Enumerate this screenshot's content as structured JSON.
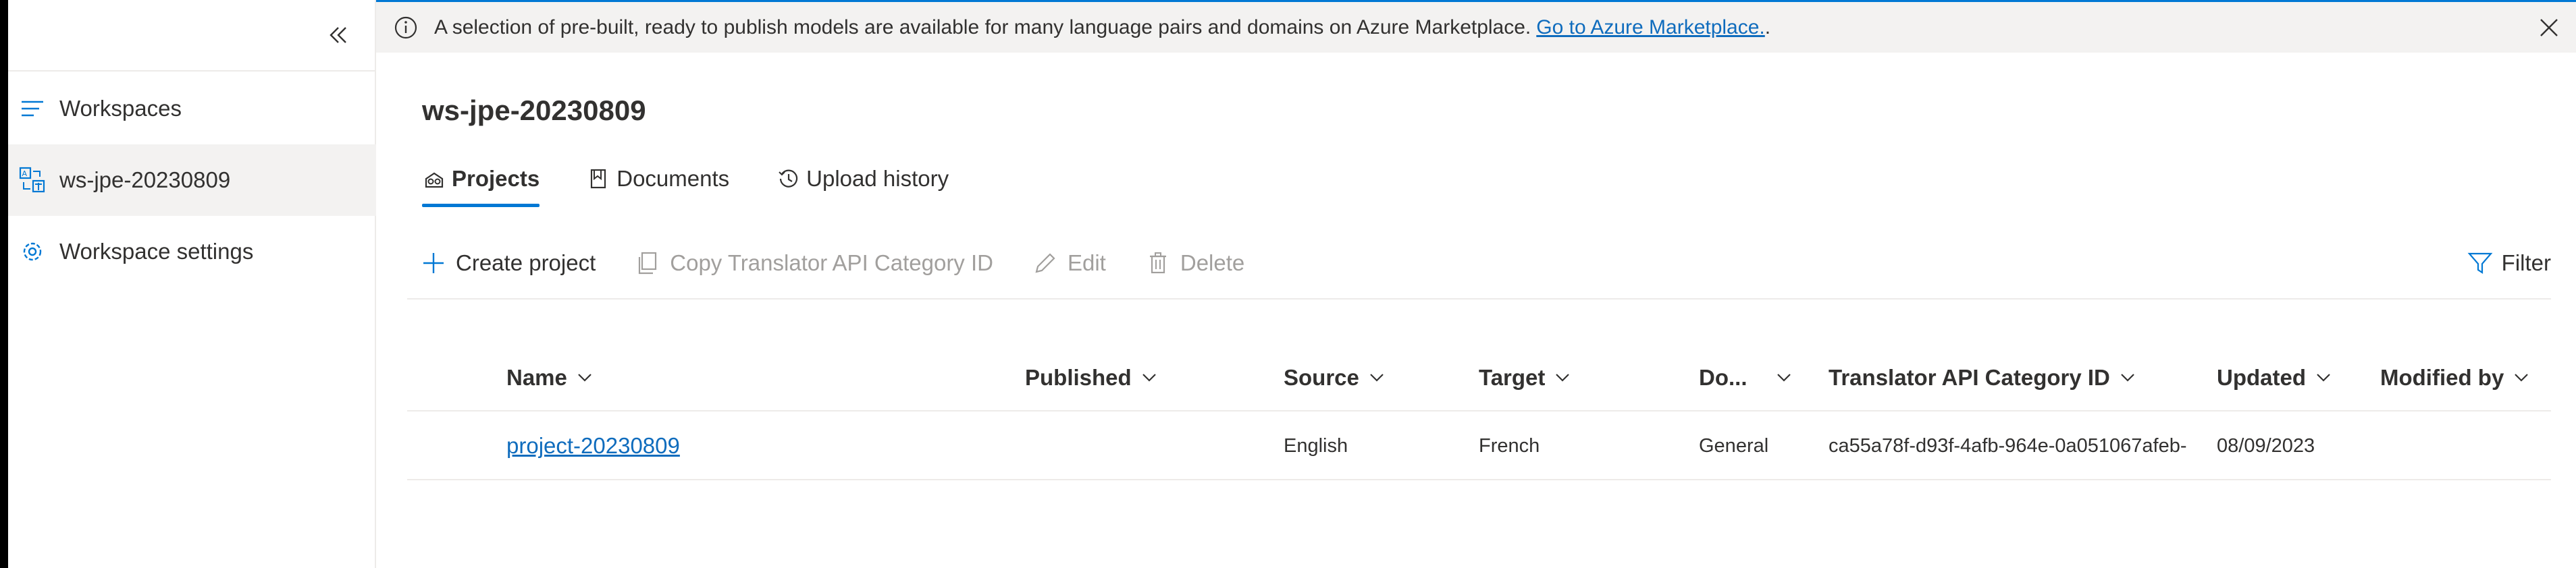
{
  "banner": {
    "message": "A selection of pre-built, ready to publish models are available for many language pairs and domains on Azure Marketplace.",
    "link_text": "Go to Azure Marketplace.",
    "trailing": "."
  },
  "sidebar": {
    "items": [
      {
        "label": "Workspaces",
        "icon": "list-icon"
      },
      {
        "label": "ws-jpe-20230809",
        "icon": "translate-icon"
      },
      {
        "label": "Workspace settings",
        "icon": "gear-icon"
      }
    ]
  },
  "workspace": {
    "title": "ws-jpe-20230809"
  },
  "tabs": [
    {
      "label": "Projects",
      "icon": "projects-icon",
      "active": true
    },
    {
      "label": "Documents",
      "icon": "documents-icon",
      "active": false
    },
    {
      "label": "Upload history",
      "icon": "history-icon",
      "active": false
    }
  ],
  "commands": {
    "create": "Create project",
    "copy": "Copy Translator API Category ID",
    "edit": "Edit",
    "delete": "Delete",
    "filter": "Filter"
  },
  "table": {
    "columns": [
      "Name",
      "Published",
      "Source",
      "Target",
      "Do...",
      "Translator API Category ID",
      "Updated",
      "Modified by"
    ],
    "rows": [
      {
        "name": "project-20230809",
        "published": "",
        "source": "English",
        "target": "French",
        "domain": "General",
        "category_id": "ca55a78f-d93f-4afb-964e-0a051067afeb-",
        "updated": "08/09/2023",
        "modified_by": ""
      }
    ]
  },
  "colors": {
    "accent": "#0078d4",
    "link": "#0f6cbd",
    "disabled_text": "#a19f9d"
  }
}
